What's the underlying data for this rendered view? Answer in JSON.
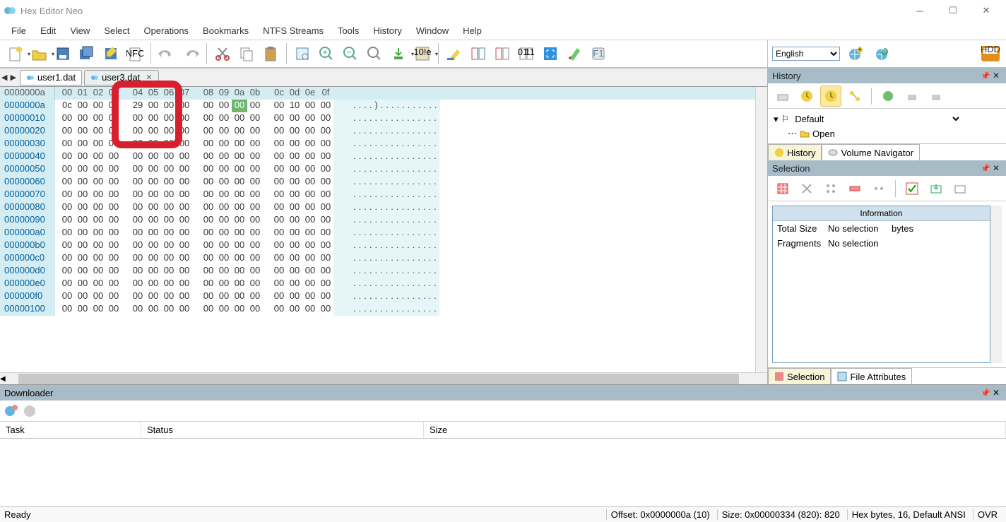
{
  "title": "Hex Editor Neo",
  "menu": [
    "File",
    "Edit",
    "View",
    "Select",
    "Operations",
    "Bookmarks",
    "NTFS Streams",
    "Tools",
    "History",
    "Window",
    "Help"
  ],
  "lang": "English",
  "tabs": [
    {
      "name": "user1.dat"
    },
    {
      "name": "user3.dat"
    }
  ],
  "hex_header": [
    "00",
    "01",
    "02",
    "03",
    "04",
    "05",
    "06",
    "07",
    "08",
    "09",
    "0a",
    "0b",
    "0c",
    "0d",
    "0e",
    "0f"
  ],
  "rows": [
    {
      "addr": "0000000a",
      "bytes": [
        "0c",
        "00",
        "00",
        "00",
        "29",
        "00",
        "00",
        "00",
        "00",
        "00",
        "00",
        "00",
        "00",
        "10",
        "00",
        "00"
      ],
      "ascii": "....)...........",
      "sel": 10
    },
    {
      "addr": "00000010",
      "bytes": [
        "00",
        "00",
        "00",
        "00",
        "00",
        "00",
        "00",
        "00",
        "00",
        "00",
        "00",
        "00",
        "00",
        "00",
        "00",
        "00"
      ],
      "ascii": "................"
    },
    {
      "addr": "00000020",
      "bytes": [
        "00",
        "00",
        "00",
        "00",
        "00",
        "00",
        "00",
        "00",
        "00",
        "00",
        "00",
        "00",
        "00",
        "00",
        "00",
        "00"
      ],
      "ascii": "................"
    },
    {
      "addr": "00000030",
      "bytes": [
        "00",
        "00",
        "00",
        "00",
        "00",
        "00",
        "00",
        "00",
        "00",
        "00",
        "00",
        "00",
        "00",
        "00",
        "00",
        "00"
      ],
      "ascii": "................"
    },
    {
      "addr": "00000040",
      "bytes": [
        "00",
        "00",
        "00",
        "00",
        "00",
        "00",
        "00",
        "00",
        "00",
        "00",
        "00",
        "00",
        "00",
        "00",
        "00",
        "00"
      ],
      "ascii": "................"
    },
    {
      "addr": "00000050",
      "bytes": [
        "00",
        "00",
        "00",
        "00",
        "00",
        "00",
        "00",
        "00",
        "00",
        "00",
        "00",
        "00",
        "00",
        "00",
        "00",
        "00"
      ],
      "ascii": "................"
    },
    {
      "addr": "00000060",
      "bytes": [
        "00",
        "00",
        "00",
        "00",
        "00",
        "00",
        "00",
        "00",
        "00",
        "00",
        "00",
        "00",
        "00",
        "00",
        "00",
        "00"
      ],
      "ascii": "................"
    },
    {
      "addr": "00000070",
      "bytes": [
        "00",
        "00",
        "00",
        "00",
        "00",
        "00",
        "00",
        "00",
        "00",
        "00",
        "00",
        "00",
        "00",
        "00",
        "00",
        "00"
      ],
      "ascii": "................"
    },
    {
      "addr": "00000080",
      "bytes": [
        "00",
        "00",
        "00",
        "00",
        "00",
        "00",
        "00",
        "00",
        "00",
        "00",
        "00",
        "00",
        "00",
        "00",
        "00",
        "00"
      ],
      "ascii": "................"
    },
    {
      "addr": "00000090",
      "bytes": [
        "00",
        "00",
        "00",
        "00",
        "00",
        "00",
        "00",
        "00",
        "00",
        "00",
        "00",
        "00",
        "00",
        "00",
        "00",
        "00"
      ],
      "ascii": "................"
    },
    {
      "addr": "000000a0",
      "bytes": [
        "00",
        "00",
        "00",
        "00",
        "00",
        "00",
        "00",
        "00",
        "00",
        "00",
        "00",
        "00",
        "00",
        "00",
        "00",
        "00"
      ],
      "ascii": "................"
    },
    {
      "addr": "000000b0",
      "bytes": [
        "00",
        "00",
        "00",
        "00",
        "00",
        "00",
        "00",
        "00",
        "00",
        "00",
        "00",
        "00",
        "00",
        "00",
        "00",
        "00"
      ],
      "ascii": "................"
    },
    {
      "addr": "000000c0",
      "bytes": [
        "00",
        "00",
        "00",
        "00",
        "00",
        "00",
        "00",
        "00",
        "00",
        "00",
        "00",
        "00",
        "00",
        "00",
        "00",
        "00"
      ],
      "ascii": "................"
    },
    {
      "addr": "000000d0",
      "bytes": [
        "00",
        "00",
        "00",
        "00",
        "00",
        "00",
        "00",
        "00",
        "00",
        "00",
        "00",
        "00",
        "00",
        "00",
        "00",
        "00"
      ],
      "ascii": "................"
    },
    {
      "addr": "000000e0",
      "bytes": [
        "00",
        "00",
        "00",
        "00",
        "00",
        "00",
        "00",
        "00",
        "00",
        "00",
        "00",
        "00",
        "00",
        "00",
        "00",
        "00"
      ],
      "ascii": "................"
    },
    {
      "addr": "000000f0",
      "bytes": [
        "00",
        "00",
        "00",
        "00",
        "00",
        "00",
        "00",
        "00",
        "00",
        "00",
        "00",
        "00",
        "00",
        "00",
        "00",
        "00"
      ],
      "ascii": "................"
    },
    {
      "addr": "00000100",
      "bytes": [
        "00",
        "00",
        "00",
        "00",
        "00",
        "00",
        "00",
        "00",
        "00",
        "00",
        "00",
        "00",
        "00",
        "00",
        "00",
        "00"
      ],
      "ascii": "................"
    }
  ],
  "header_addr": "0000000a",
  "history": {
    "title": "History",
    "root": "Default",
    "child": "Open"
  },
  "history_tabs": [
    "History",
    "Volume Navigator"
  ],
  "selection": {
    "title": "Selection",
    "info_hdr": "Information",
    "rows": [
      [
        "Total Size",
        "No selection",
        "bytes"
      ],
      [
        "Fragments",
        "No selection",
        ""
      ]
    ]
  },
  "selection_tabs": [
    "Selection",
    "File Attributes"
  ],
  "downloader": {
    "title": "Downloader",
    "cols": [
      "Task",
      "Status",
      "Size"
    ]
  },
  "status": {
    "ready": "Ready",
    "offset": "Offset: 0x0000000a (10)",
    "size": "Size: 0x00000334 (820): 820",
    "mode": "Hex bytes, 16, Default ANSI",
    "ovr": "OVR"
  }
}
